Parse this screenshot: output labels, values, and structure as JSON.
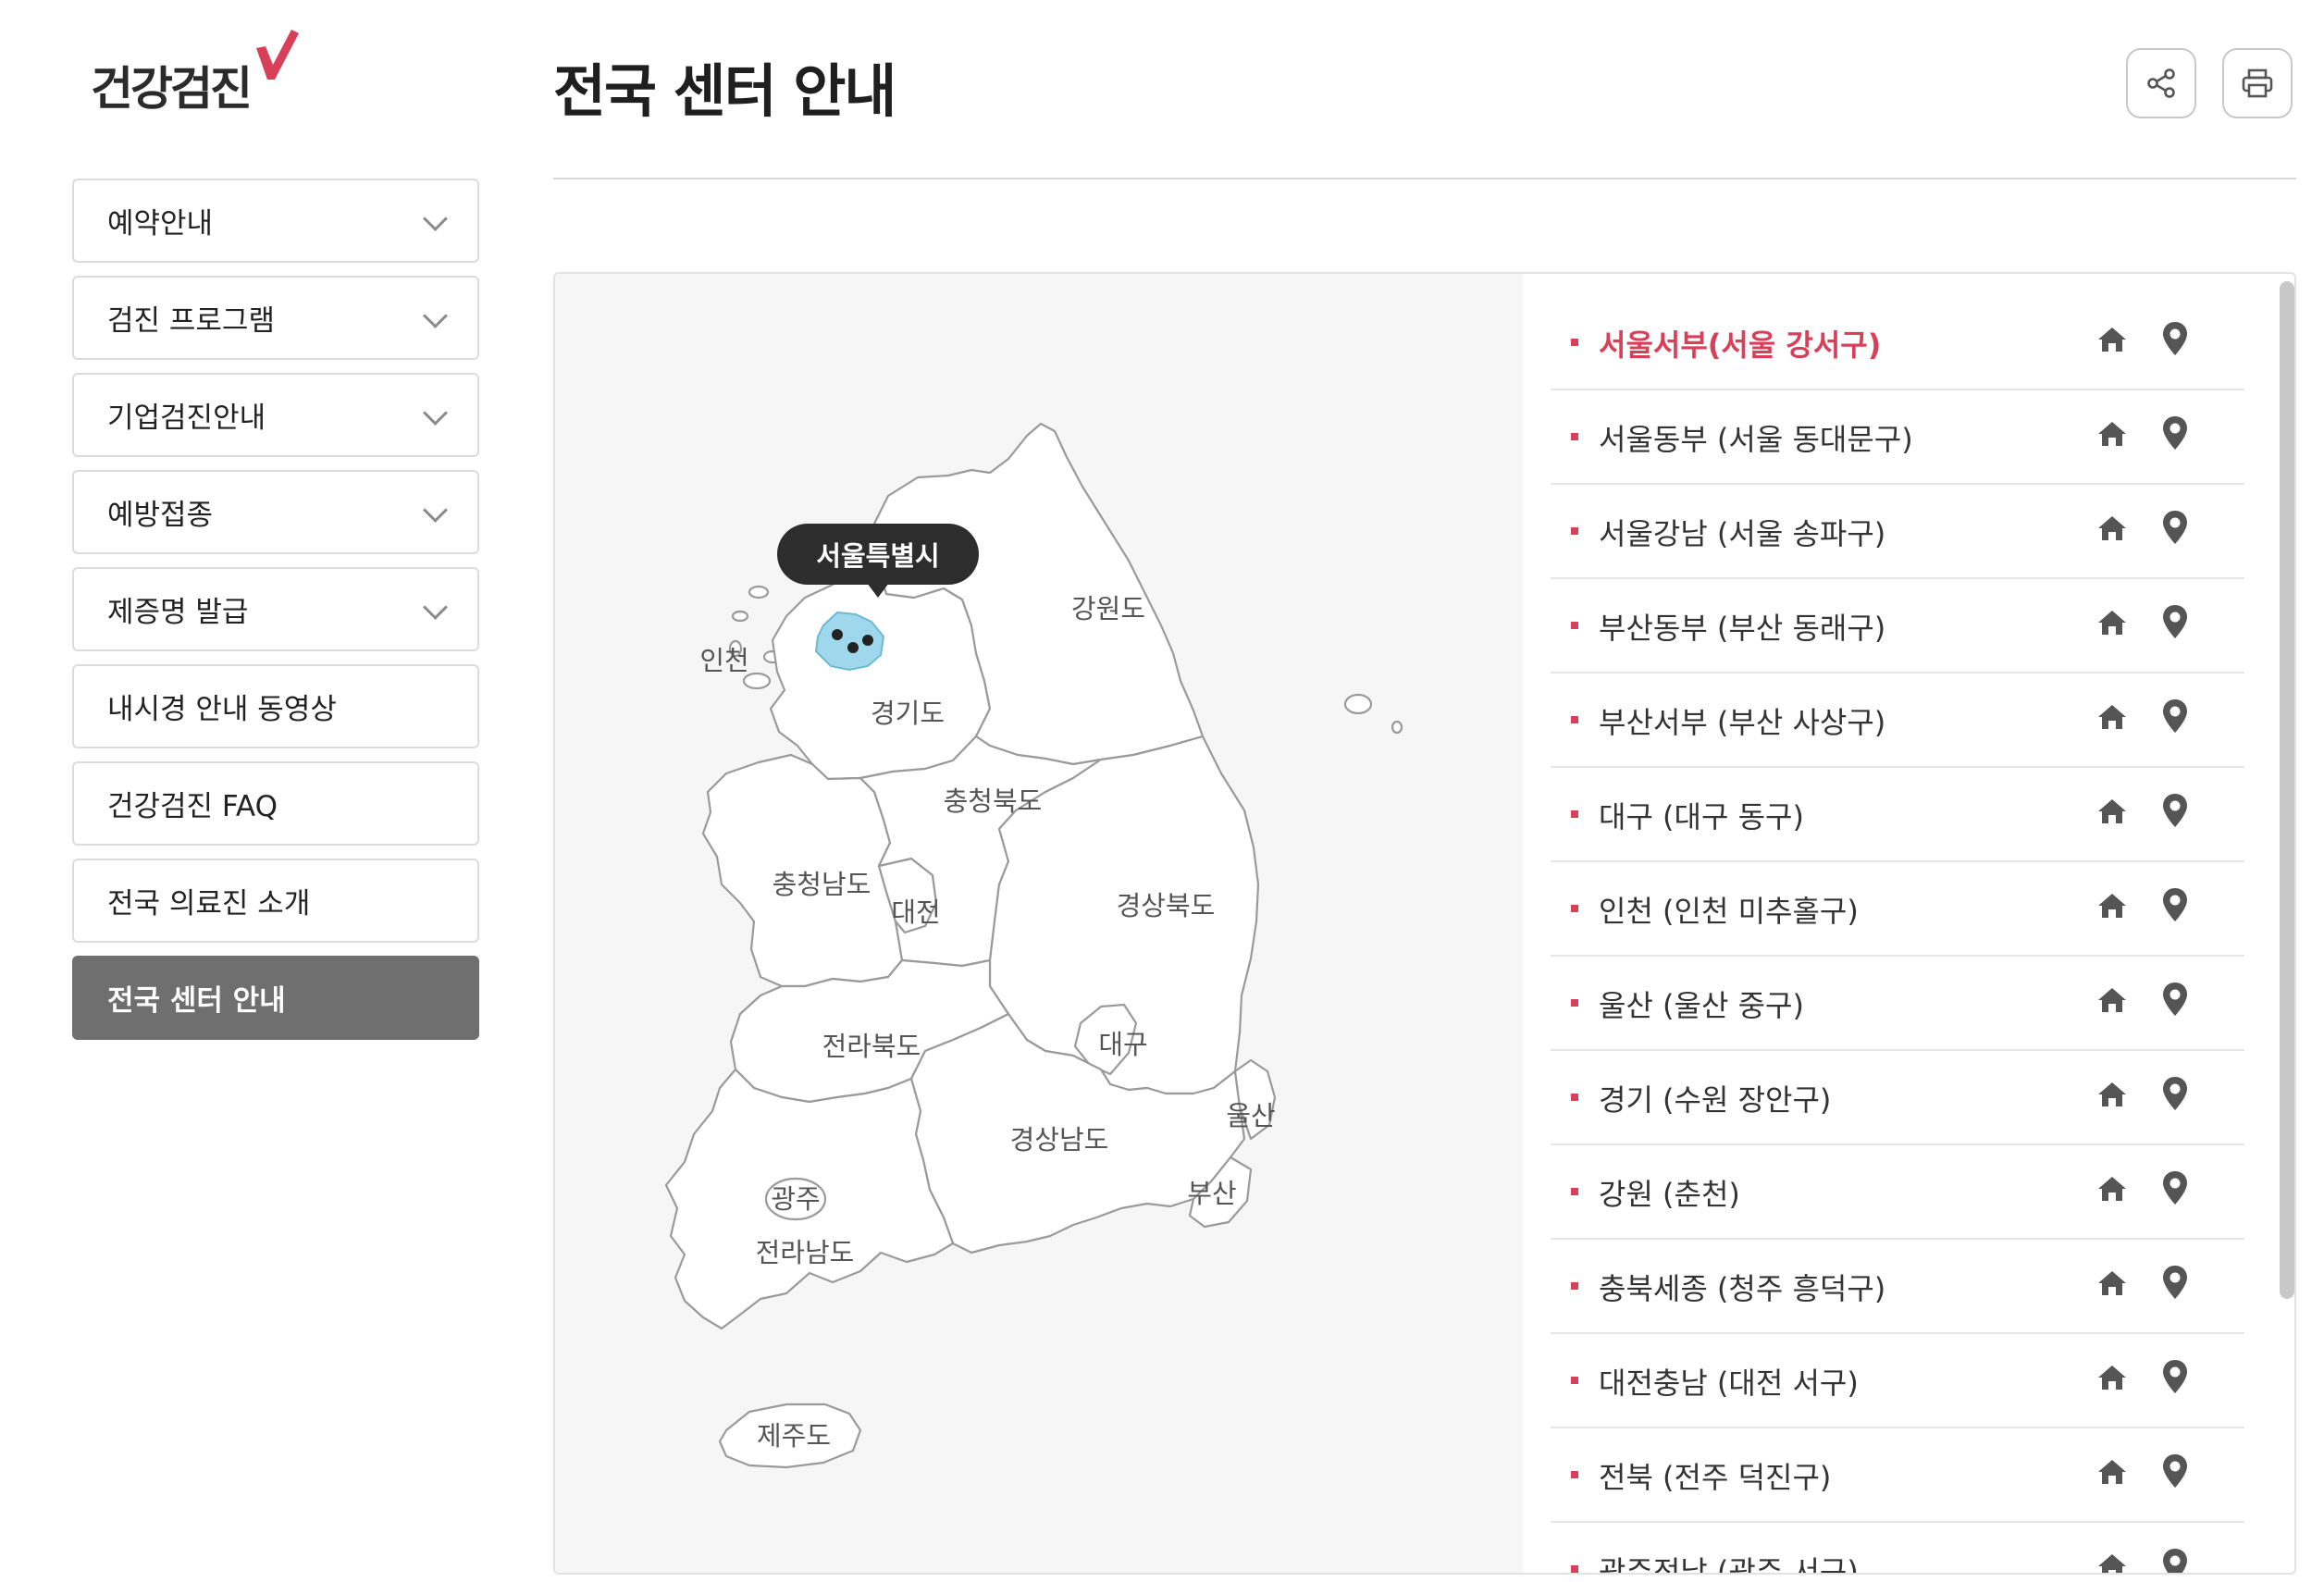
{
  "logo": {
    "text": "건강검진",
    "icon": "red-check-icon",
    "accent": "#d8405a"
  },
  "sidebar": {
    "items": [
      {
        "label": "예약안내",
        "expandable": true
      },
      {
        "label": "검진 프로그램",
        "expandable": true
      },
      {
        "label": "기업검진안내",
        "expandable": true
      },
      {
        "label": "예방접종",
        "expandable": true
      },
      {
        "label": "제증명 발급",
        "expandable": true
      },
      {
        "label": "내시경 안내 동영상",
        "expandable": false
      },
      {
        "label": "건강검진 FAQ",
        "expandable": false
      },
      {
        "label": "전국 의료진 소개",
        "expandable": false
      },
      {
        "label": "전국 센터 안내",
        "expandable": false,
        "active": true
      }
    ]
  },
  "header": {
    "title": "전국 센터 안내",
    "share_icon": "share-icon",
    "print_icon": "printer-icon"
  },
  "map": {
    "tooltip": "서울특별시",
    "selected_region": "서울",
    "selected_color": "#9fd8ec",
    "labels": {
      "incheon": "인천",
      "gyeonggi": "경기도",
      "gangwon": "강원도",
      "chungbuk": "충청북도",
      "chungnam": "충청남도",
      "daejeon": "대전",
      "gyeongbuk": "경상북도",
      "jeonbuk": "전라북도",
      "daegu": "대구",
      "ulsan": "울산",
      "gyeongnam": "경상남도",
      "busan": "부산",
      "gwangju": "광주",
      "jeonnam": "전라남도",
      "jeju": "제주도"
    }
  },
  "centers": [
    {
      "name": "서울서부(서울 강서구)",
      "selected": true
    },
    {
      "name": "서울동부 (서울 동대문구)"
    },
    {
      "name": "서울강남 (서울 송파구)"
    },
    {
      "name": "부산동부 (부산 동래구)"
    },
    {
      "name": "부산서부 (부산 사상구)"
    },
    {
      "name": "대구 (대구 동구)"
    },
    {
      "name": "인천 (인천 미추홀구)"
    },
    {
      "name": "울산 (울산 중구)"
    },
    {
      "name": "경기 (수원 장안구)"
    },
    {
      "name": "강원 (춘천)"
    },
    {
      "name": "충북세종 (청주 흥덕구)"
    },
    {
      "name": "대전충남 (대전 서구)"
    },
    {
      "name": "전북 (전주 덕진구)"
    },
    {
      "name": "광주전남 (광주 서구)"
    }
  ],
  "row_icons": {
    "home": "home-icon",
    "location": "map-pin-icon"
  }
}
